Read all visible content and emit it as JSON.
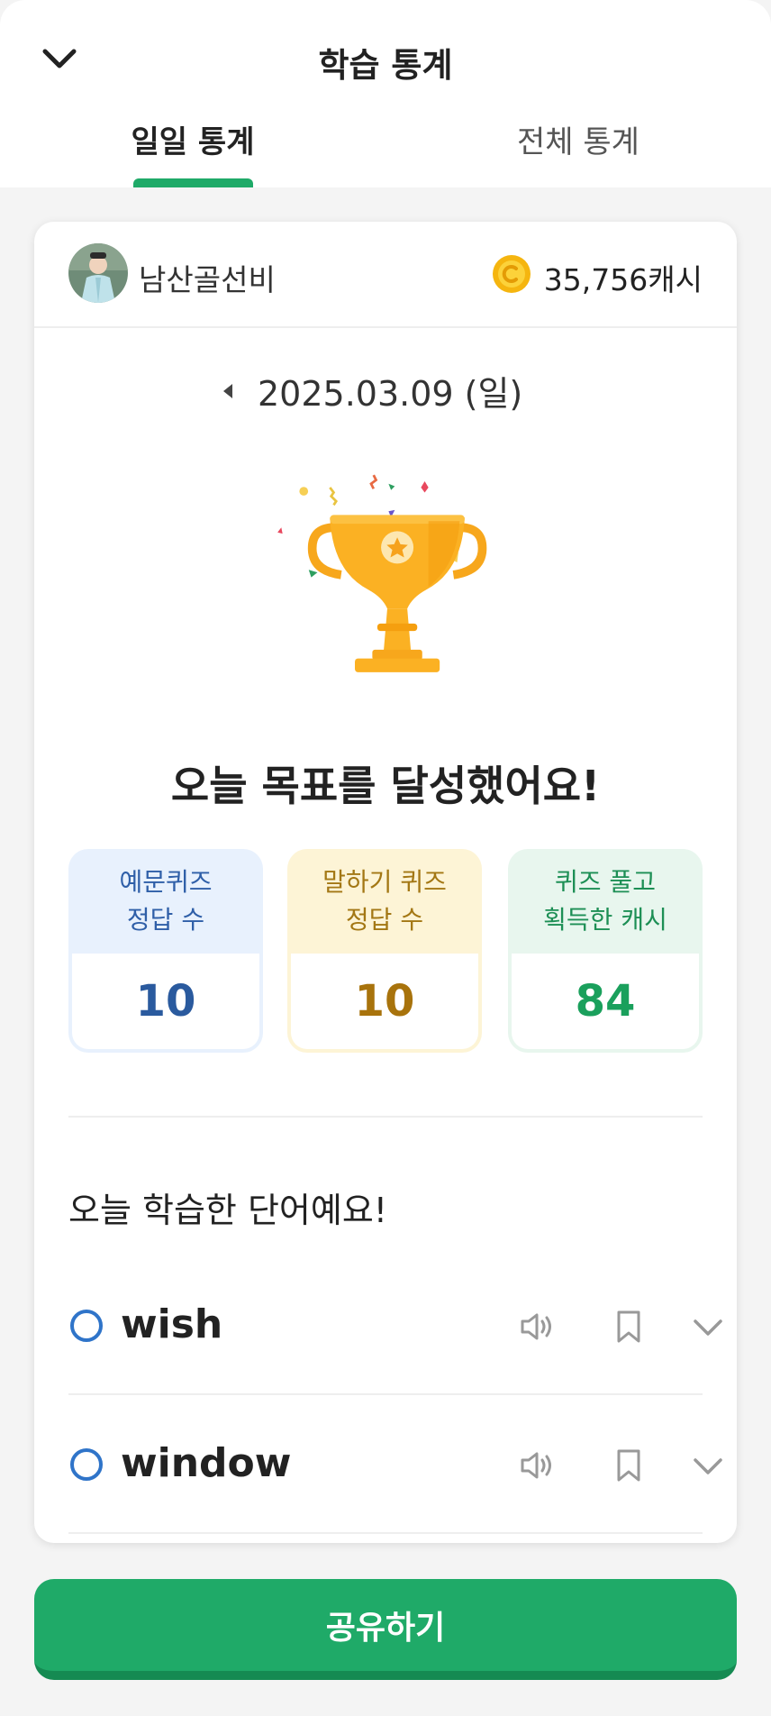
{
  "header": {
    "title": "학습 통계",
    "tabs": [
      {
        "label": "일일 통계",
        "active": true
      },
      {
        "label": "전체 통계",
        "active": false
      }
    ],
    "accent_color": "#1faa68"
  },
  "profile": {
    "username": "남산골선비",
    "cash": "35,756캐시"
  },
  "date": {
    "label": "2025.03.09 (일)"
  },
  "goal": {
    "message": "오늘 목표를 달성했어요!"
  },
  "stats": [
    {
      "line1": "예문퀴즈",
      "line2": "정답 수",
      "value": "10",
      "color": "#2a5a9e"
    },
    {
      "line1": "말하기 퀴즈",
      "line2": "정답 수",
      "value": "10",
      "color": "#a8730c"
    },
    {
      "line1": "퀴즈 풀고",
      "line2": "획득한 캐시",
      "value": "84",
      "color": "#1aa05c"
    }
  ],
  "words": {
    "title": "오늘 학습한 단어예요!",
    "items": [
      {
        "word": "wish"
      },
      {
        "word": "window"
      }
    ]
  },
  "share": {
    "label": "공유하기"
  }
}
